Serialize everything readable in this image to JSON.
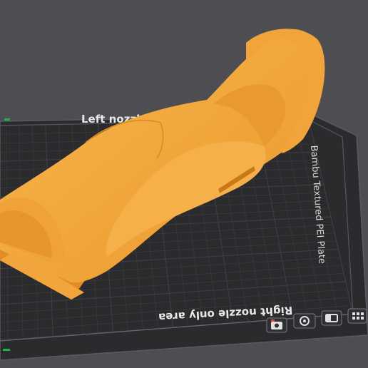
{
  "viewport": {
    "background_color": "#4d4d52",
    "plate_color": "#2b2b2e",
    "grid_color": "#3e3e42",
    "model_color": "#f5ab3f",
    "accent_color": "#20b14c"
  },
  "plate": {
    "top_label": "Left nozzle",
    "bottom_label": "Right nozzle only area",
    "side_label": "Bambu Textured PEI Plate"
  },
  "model": {
    "name": "3d-printed-model"
  },
  "toolbar": {
    "buttons": [
      {
        "icon": "camera-icon"
      },
      {
        "icon": "orient-icon"
      },
      {
        "icon": "view-icon"
      },
      {
        "icon": "grid-icon"
      }
    ]
  }
}
